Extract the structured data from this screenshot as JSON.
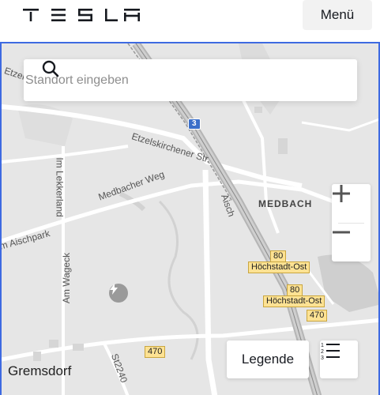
{
  "header": {
    "logo": "TESLA",
    "menu_label": "Menü"
  },
  "search": {
    "placeholder": "Standort eingeben"
  },
  "map": {
    "streets": [
      {
        "name": "Etzelskirchener Str."
      },
      {
        "name": "Etzels"
      },
      {
        "name": "Medbacher Weg"
      },
      {
        "name": "Im Lekkerland"
      },
      {
        "name": "Am Aischpark"
      },
      {
        "name": "Am Wageck"
      },
      {
        "name": "Aisch"
      },
      {
        "name": "St2240"
      }
    ],
    "towns": [
      {
        "name": "MEDBACH"
      },
      {
        "name": "Gremsdorf"
      }
    ],
    "exits": [
      {
        "number": "80",
        "name": "Höchstadt-Ost"
      },
      {
        "number": "80",
        "name": "Höchstadt-Ost"
      }
    ],
    "routes": [
      "470",
      "470"
    ],
    "motorway": "3"
  },
  "controls": {
    "zoom_in_icon": "plus-icon",
    "zoom_out_icon": "minus-icon",
    "legend_label": "Legende",
    "list_icon": "numbered-list-icon"
  }
}
